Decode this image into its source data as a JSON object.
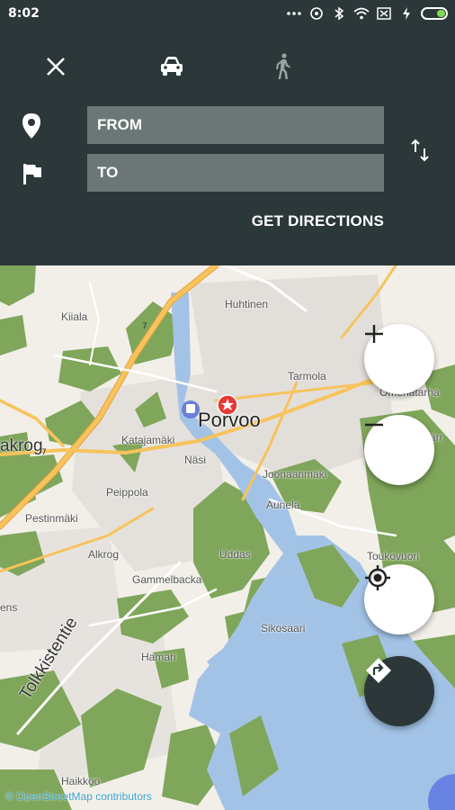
{
  "status_bar": {
    "time": "8:02",
    "battery_level": 0.35
  },
  "directions": {
    "close_icon": "close-icon",
    "modes": [
      "car-icon",
      "walk-icon"
    ],
    "from_placeholder": "FROM",
    "to_placeholder": "TO",
    "get_directions_label": "GET DIRECTIONS"
  },
  "map": {
    "labels": {
      "kiiala": "Kiiala",
      "huhtinen": "Huhtinen",
      "tarmola": "Tarmola",
      "omenatarha": "Omenatarha",
      "porvoo": "Porvoo",
      "katajamaki": "Katajamäki",
      "akrog": "akrog",
      "nasi": "Näsi",
      "joonaanmaki": "Joonaanmäki",
      "arr": "ärr",
      "peippola": "Peippola",
      "aunela": "Aunela",
      "pestinmaki": "Pestinmäki",
      "alkrog": "Alkrog",
      "uddas": "Uddas",
      "toukovuori": "Toukovuori",
      "gammelbacka": "Gammelbacka",
      "ens": "ens",
      "sikosaari": "Sikosaari",
      "tolkkistentie": "Tolkkistentie",
      "hamari": "Hamari",
      "haikkoo": "Haikkoo"
    },
    "attribution": "© OpenStreetMap contributors",
    "colors": {
      "water": "#a3c3e6",
      "forest": "#7fa65a",
      "land": "#f2efe9",
      "road_major": "#f7c35c",
      "road_minor": "#ffffff"
    }
  },
  "controls": {
    "zoom_in": "plus-icon",
    "zoom_out": "minus-icon",
    "locate": "my-location-icon",
    "navigate": "directions-icon"
  }
}
